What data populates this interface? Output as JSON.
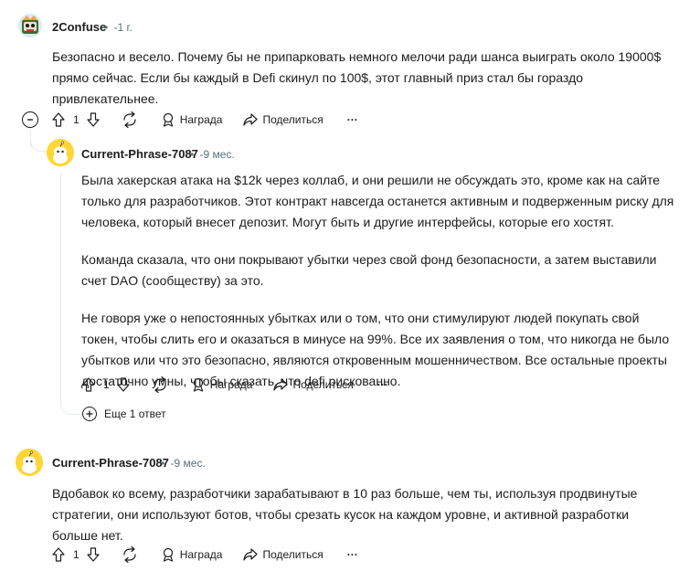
{
  "comments": [
    {
      "user": "2Confuse",
      "time": "-1 г.",
      "paragraphs": [
        "Безопасно и весело. Почему бы не припарковать немного мелочи ради шанса выиграть около 19000$ прямо сейчас. Если бы каждый в Defi скинул по 100$, этот главный приз стал бы гораздо привлекательнее."
      ],
      "score": "1",
      "award_label": "Награда",
      "share_label": "Поделиться",
      "more": "···"
    },
    {
      "user": "Current-Phrase-7087",
      "time": "-9 мес.",
      "paragraphs": [
        "Была хакерская атака на $12k через коллаб, и они решили не обсуждать это, кроме как на сайте только для разработчиков. Этот контракт навсегда останется активным и подверженным риску для человека, который внесет депозит. Могут быть и другие интерфейсы, которые его хостят.",
        "Команда сказала, что они покрывают убытки через свой фонд безопасности, а затем выставили счет DAO (сообществу) за это.",
        "Не говоря уже о непостоянных убытках или о том, что они стимулируют людей покупать свой токен, чтобы слить его и оказаться в минусе на 99%. Все их заявления о том, что никогда не было убытков или что это безопасно, являются откровенным мошенничеством. Все остальные проекты достаточно умны, чтобы сказать, что defi рискованно."
      ],
      "score": "1",
      "award_label": "Награда",
      "share_label": "Поделиться",
      "more": "···",
      "more_replies": "Еще 1 ответ"
    },
    {
      "user": "Current-Phrase-7087",
      "time": "-9 мес.",
      "paragraphs": [
        "Вдобавок ко всему, разработчики зарабатывают в 10 раз больше, чем ты, используя продвинутые стратегии, они используют ботов, чтобы срезать кусок на каждом уровне, и активной разработки больше нет."
      ],
      "score": "1",
      "award_label": "Награда",
      "share_label": "Поделиться",
      "more": "···"
    }
  ],
  "separator": "•",
  "icons": {
    "collapse": "collapse-minus-icon",
    "upvote": "upvote-arrow-icon",
    "downvote": "downvote-arrow-icon",
    "reply": "reply-icon",
    "award": "award-icon",
    "share": "share-icon",
    "expand": "expand-plus-icon"
  }
}
